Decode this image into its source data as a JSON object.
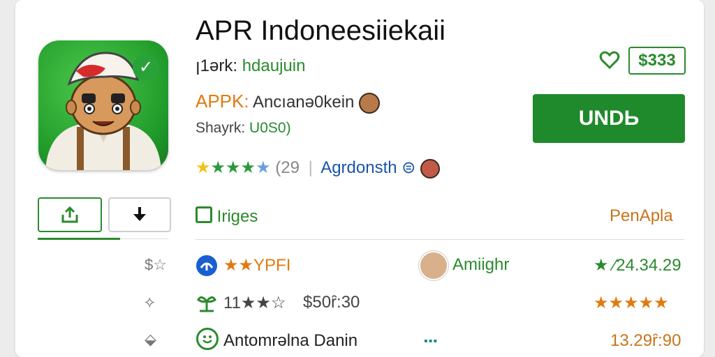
{
  "app": {
    "title": "APR Indoneesiiekaii",
    "developer_prefix": "ꞁ1ərk:",
    "developer_name": "hdaujuin",
    "type_label": "APPK:",
    "type_value": "Ancıanə0kein",
    "size_label": "Shayrk:",
    "size_value": "U0S0)",
    "rating_count": "(29",
    "category": "Agrdonsth",
    "price": "$333",
    "install_label": "UNDЬ"
  },
  "section": {
    "title": "Iriges",
    "link": "PenApla"
  },
  "rows": [
    {
      "side": "$☆",
      "main": "★★YPFI",
      "name": "Amiighr",
      "value": "★ ⁄24.34.29"
    },
    {
      "side": "⟡",
      "main": "11★★☆",
      "extra": "$50ȓ:30",
      "value": "★★★★★"
    },
    {
      "side": "⬙",
      "main": "Antomrəlna Danin",
      "value": "13.29ȓ:90"
    }
  ],
  "colors": {
    "accent_green": "#1f8a2b",
    "orange": "#e07a10",
    "link_blue": "#1a55a8"
  },
  "icons": [
    "share-icon",
    "download-icon",
    "heart-icon",
    "check-icon",
    "star-icon",
    "image-icon",
    "chart-icon",
    "sprout-icon",
    "smile-icon"
  ]
}
